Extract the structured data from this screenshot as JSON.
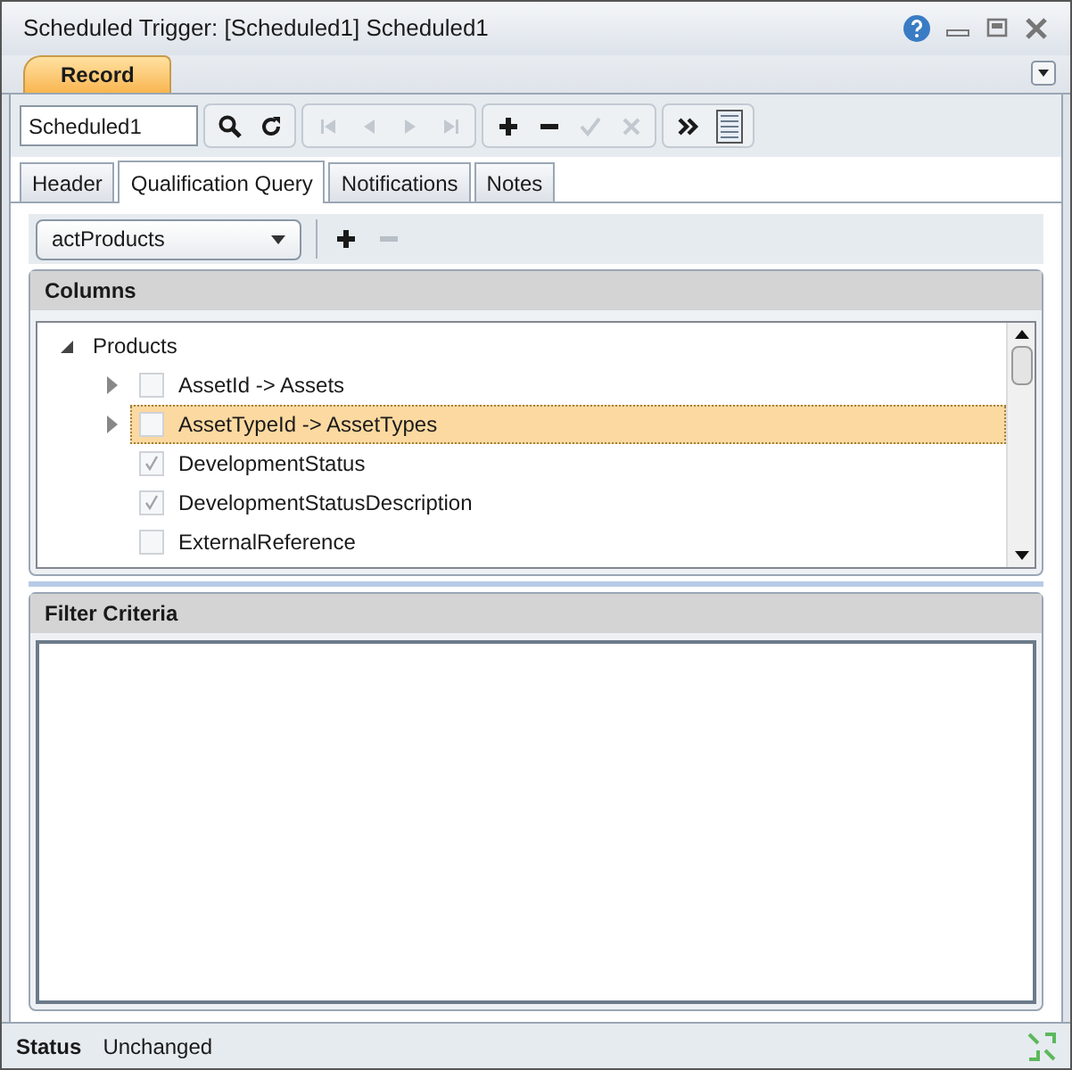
{
  "window": {
    "title": "Scheduled Trigger: [Scheduled1] Scheduled1"
  },
  "ribbon_tab": {
    "label": "Record",
    "selected": true
  },
  "record_field": {
    "value": "Scheduled1"
  },
  "toolbar": [
    {
      "buttons": [
        {
          "kind": "search",
          "disabled": false
        },
        {
          "kind": "refresh",
          "disabled": false
        }
      ]
    },
    {
      "buttons": [
        {
          "kind": "first",
          "disabled": true
        },
        {
          "kind": "prev",
          "disabled": true
        },
        {
          "kind": "next",
          "disabled": true
        },
        {
          "kind": "last",
          "disabled": true
        }
      ]
    },
    {
      "buttons": [
        {
          "kind": "add",
          "disabled": false
        },
        {
          "kind": "remove",
          "disabled": false
        },
        {
          "kind": "save",
          "disabled": true
        },
        {
          "kind": "cancel",
          "disabled": true
        }
      ]
    },
    {
      "buttons": [
        {
          "kind": "more",
          "disabled": false
        },
        {
          "kind": "list",
          "disabled": false
        }
      ]
    }
  ],
  "tabs": [
    {
      "label": "Header",
      "selected": false
    },
    {
      "label": "Qualification Query",
      "selected": true
    },
    {
      "label": "Notifications",
      "selected": false
    },
    {
      "label": "Notes",
      "selected": false
    }
  ],
  "query_select": {
    "value": "actProducts"
  },
  "query_buttons": [
    {
      "kind": "add",
      "disabled": false
    },
    {
      "kind": "remove",
      "disabled": true
    }
  ],
  "columns_panel": {
    "title": "Columns",
    "tree": [
      {
        "label": "Products",
        "expanded": true,
        "children": [
          {
            "label": "AssetId -> Assets",
            "expanded": false,
            "checked": false,
            "selected": false
          },
          {
            "label": "AssetTypeId -> AssetTypes",
            "expanded": false,
            "checked": false,
            "selected": true
          },
          {
            "label": "DevelopmentStatus",
            "checked": true,
            "selected": false
          },
          {
            "label": "DevelopmentStatusDescription",
            "checked": true,
            "selected": false
          },
          {
            "label": "ExternalReference",
            "checked": false,
            "selected": false
          }
        ]
      }
    ]
  },
  "filter_panel": {
    "title": "Filter Criteria"
  },
  "status_bar": {
    "label": "Status",
    "value": "Unchanged"
  }
}
